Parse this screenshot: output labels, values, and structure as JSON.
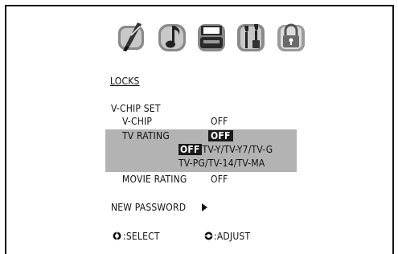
{
  "menu": {
    "icons": [
      "picture-brush-icon",
      "audio-note-icon",
      "setup-icon",
      "tools-icon",
      "lock-icon"
    ],
    "title": "LOCKS",
    "vchip_set_label": "V-CHIP SET",
    "vchip": {
      "label": "V-CHIP",
      "value": "OFF"
    },
    "tv_rating": {
      "label": "TV RATING",
      "value": "OFF",
      "options_selected": "OFF",
      "options_line1": "TV-Y/TV-Y7/TV-G",
      "options_line2": "TV-PG/TV-14/TV-MA"
    },
    "movie_rating": {
      "label": "MOVIE RATING",
      "value": "OFF"
    },
    "new_password": {
      "label": "NEW PASSWORD"
    }
  },
  "footer": {
    "select_label": ":SELECT",
    "adjust_label": ":ADJUST"
  },
  "colors": {
    "highlight": "#b3b3b3",
    "selected_bg": "#1a1a1a",
    "icon_gray": "#8a8a8a",
    "icon_dark": "#444444"
  }
}
